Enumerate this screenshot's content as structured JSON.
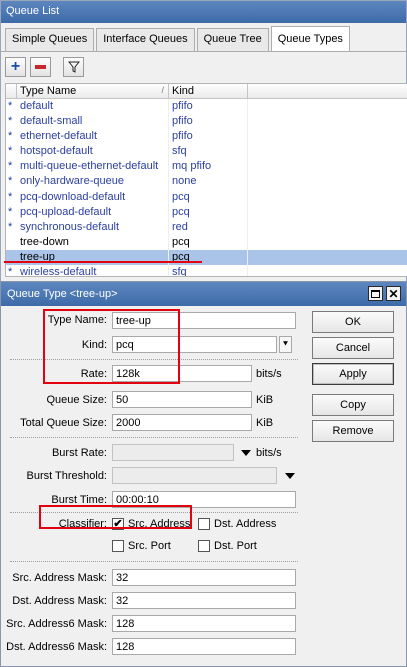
{
  "queue_list": {
    "title": "Queue List",
    "tabs": [
      "Simple Queues",
      "Interface Queues",
      "Queue Tree",
      "Queue Types"
    ],
    "active_tab": "Queue Types",
    "toolbar": {
      "add_icon": "plus-icon",
      "remove_icon": "minus-icon",
      "filter_icon": "filter-icon"
    },
    "columns": {
      "type_name": "Type Name",
      "kind": "Kind"
    },
    "rows": [
      {
        "marker": "*",
        "name": "default",
        "kind": "pfifo"
      },
      {
        "marker": "*",
        "name": "default-small",
        "kind": "pfifo"
      },
      {
        "marker": "*",
        "name": "ethernet-default",
        "kind": "pfifo"
      },
      {
        "marker": "*",
        "name": "hotspot-default",
        "kind": "sfq"
      },
      {
        "marker": "*",
        "name": "multi-queue-ethernet-default",
        "kind": "mq pfifo"
      },
      {
        "marker": "*",
        "name": "only-hardware-queue",
        "kind": "none"
      },
      {
        "marker": "*",
        "name": "pcq-download-default",
        "kind": "pcq"
      },
      {
        "marker": "*",
        "name": "pcq-upload-default",
        "kind": "pcq"
      },
      {
        "marker": "*",
        "name": "synchronous-default",
        "kind": "red"
      },
      {
        "marker": "",
        "name": "tree-down",
        "kind": "pcq"
      },
      {
        "marker": "",
        "name": "tree-up",
        "kind": "pcq"
      },
      {
        "marker": "*",
        "name": "wireless-default",
        "kind": "sfq"
      }
    ],
    "selected_row": "tree-up"
  },
  "queue_type": {
    "title": "Queue Type <tree-up>",
    "fields": {
      "type_name_label": "Type Name:",
      "type_name": "tree-up",
      "kind_label": "Kind:",
      "kind": "pcq",
      "rate_label": "Rate:",
      "rate": "128k",
      "rate_unit": "bits/s",
      "queue_size_label": "Queue Size:",
      "queue_size": "50",
      "queue_size_unit": "KiB",
      "total_queue_size_label": "Total Queue Size:",
      "total_queue_size": "2000",
      "total_queue_size_unit": "KiB",
      "burst_rate_label": "Burst Rate:",
      "burst_rate": "",
      "burst_rate_unit": "bits/s",
      "burst_threshold_label": "Burst Threshold:",
      "burst_threshold": "",
      "burst_time_label": "Burst Time:",
      "burst_time": "00:00:10",
      "classifier_label": "Classifier:",
      "src_address_label": "Src. Address",
      "src_address_checked": true,
      "dst_address_label": "Dst. Address",
      "dst_address_checked": false,
      "src_port_label": "Src. Port",
      "src_port_checked": false,
      "dst_port_label": "Dst. Port",
      "dst_port_checked": false,
      "src_address_mask_label": "Src. Address Mask:",
      "src_address_mask": "32",
      "dst_address_mask_label": "Dst. Address Mask:",
      "dst_address_mask": "32",
      "src_address6_mask_label": "Src. Address6 Mask:",
      "src_address6_mask": "128",
      "dst_address6_mask_label": "Dst. Address6 Mask:",
      "dst_address6_mask": "128"
    },
    "buttons": {
      "ok": "OK",
      "cancel": "Cancel",
      "apply": "Apply",
      "copy": "Copy",
      "remove": "Remove"
    },
    "check_mark": "✔",
    "dropdown_glyph": "⯆",
    "annotation_color": "#e3000f"
  }
}
